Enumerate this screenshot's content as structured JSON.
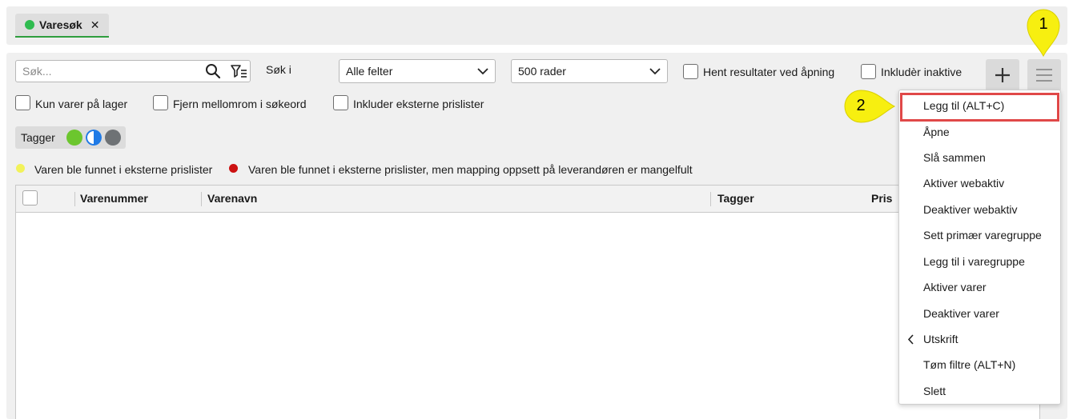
{
  "tab": {
    "label": "Varesøk",
    "close": "✕"
  },
  "search": {
    "placeholder": "Søk...",
    "search_in_label": "Søk i"
  },
  "selects": {
    "fields": "Alle felter",
    "rows": "500 rader"
  },
  "checkboxes": {
    "fetch_on_open": "Hent resultater ved åpning",
    "include_inactive": "Inkludèr inaktive",
    "only_in_stock": "Kun varer på lager",
    "remove_spaces": "Fjern mellomrom i søkeord",
    "include_external": "Inkluder eksterne prislister"
  },
  "tagger": {
    "label": "Tagger"
  },
  "legend": {
    "yellow": "Varen ble funnet i eksterne prislister",
    "red": "Varen ble funnet i eksterne prislister, men mapping oppsett på leverandøren er mangelfult"
  },
  "table": {
    "columns": [
      "Varenummer",
      "Varenavn",
      "Tagger",
      "Pris"
    ]
  },
  "menu": {
    "items": [
      "Legg til (ALT+C)",
      "Åpne",
      "Slå sammen",
      "Aktiver webaktiv",
      "Deaktiver webaktiv",
      "Sett primær varegruppe",
      "Legg til i varegruppe",
      "Aktiver varer",
      "Deaktiver varer",
      "Utskrift",
      "Tøm filtre (ALT+N)",
      "Slett"
    ]
  },
  "callouts": {
    "one": "1",
    "two": "2"
  },
  "colors": {
    "status_green": "#2fbb4f",
    "tag_green": "#6cc62e",
    "tag_blue": "#1f7ae6",
    "tag_gray": "#6e7275",
    "legend_yellow": "#f2f25a",
    "legend_red": "#cc1111",
    "callout_yellow": "#f7ef10",
    "highlight_red": "#e04848"
  },
  "icons": [
    "search-icon",
    "filter-icon",
    "chevron-down-icon",
    "plus-icon",
    "hamburger-menu-icon",
    "chevron-left-icon",
    "close-icon"
  ]
}
